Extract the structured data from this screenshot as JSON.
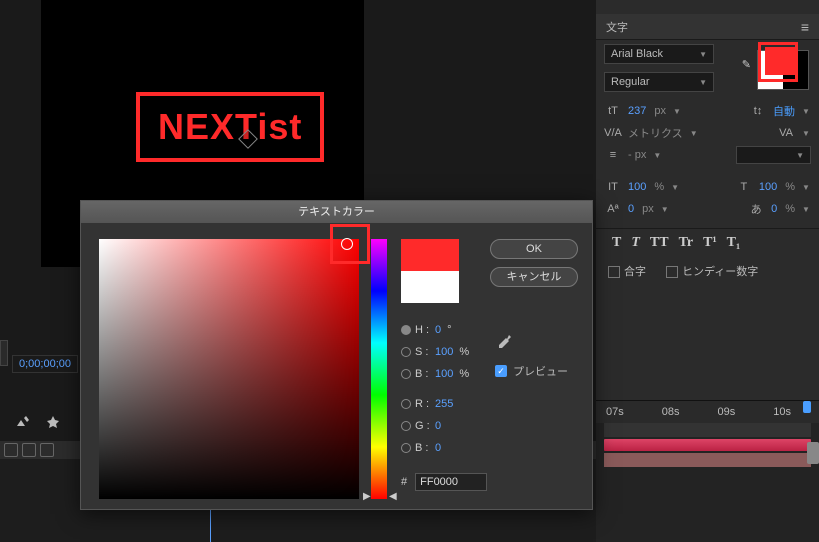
{
  "comp": {
    "text": "NEXTist"
  },
  "timeline": {
    "timecode": "0;00;00;00"
  },
  "char_panel": {
    "tab": "文字",
    "font": "Arial Black",
    "style": "Regular",
    "size_icon": "tT",
    "size": "237",
    "size_unit": "px",
    "leading_icon": "t↕",
    "leading": "自動",
    "kerning_icon": "V/A",
    "kerning": "メトリクス",
    "tracking_icon": "VA",
    "stroke": "- px",
    "hscale": "100",
    "hscale_unit": "%",
    "vscale": "100",
    "vscale_unit": "%",
    "baseline": "0",
    "baseline_unit": "px",
    "tsume": "0",
    "tsume_unit": "%",
    "styles": [
      "T",
      "T",
      "TT",
      "Tr",
      "T¹",
      "T₁"
    ],
    "ligature": "合字",
    "hindi": "ヒンディー数字"
  },
  "rtimeline": {
    "t1": "07s",
    "t2": "08s",
    "t3": "09s",
    "t4": "10s"
  },
  "dialog": {
    "title": "テキストカラー",
    "ok": "OK",
    "cancel": "キャンセル",
    "preview": "プレビュー",
    "h_label": "H :",
    "h_val": "0",
    "h_suf": "°",
    "s_label": "S :",
    "s_val": "100",
    "s_suf": "%",
    "b_label": "B :",
    "b_val": "100",
    "b_suf": "%",
    "r_label": "R :",
    "r_val": "255",
    "g_label": "G :",
    "g_val": "0",
    "bl_label": "B :",
    "bl_val": "0",
    "hex_label": "#",
    "hex_val": "FF0000"
  }
}
